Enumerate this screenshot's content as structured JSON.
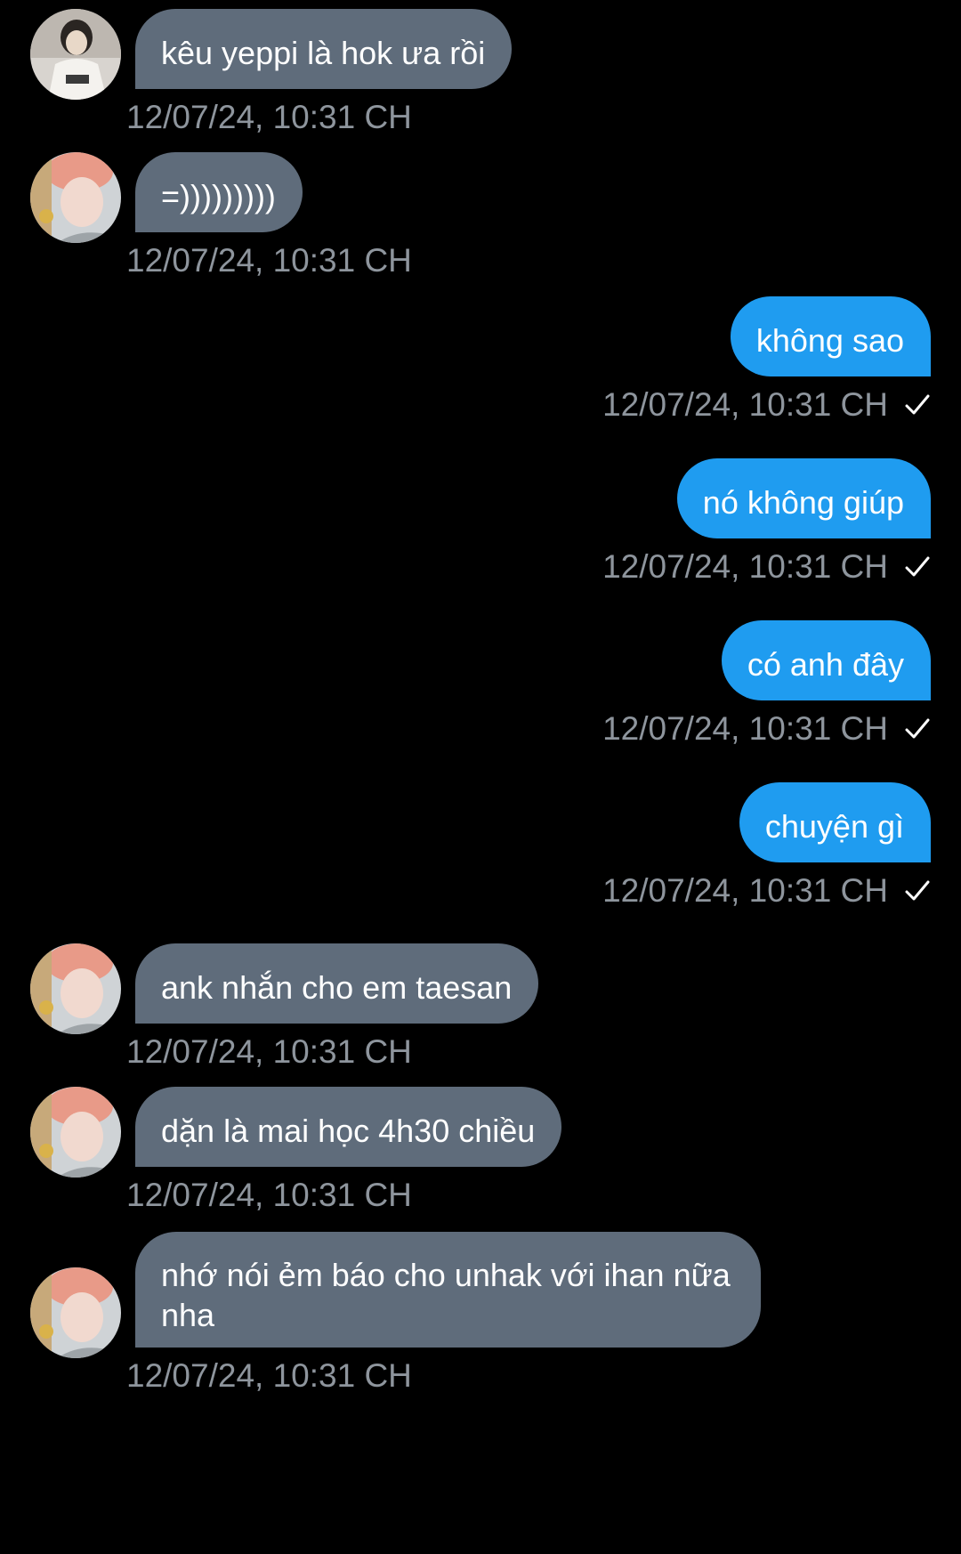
{
  "colors": {
    "background": "#000000",
    "incoming_bubble": "#5f6c7b",
    "outgoing_bubble": "#1f9cf0",
    "timestamp": "#8e959d"
  },
  "messages": [
    {
      "direction": "incoming",
      "avatar": "avatar-user-1",
      "text": "kêu yeppi là hok ưa rồi",
      "time": "12/07/24, 10:31 CH"
    },
    {
      "direction": "incoming",
      "avatar": "avatar-user-2",
      "text": "=)))))))))",
      "time": "12/07/24, 10:31 CH"
    },
    {
      "direction": "outgoing",
      "text": "không sao",
      "time": "12/07/24, 10:31 CH",
      "status_icon": "check-icon"
    },
    {
      "direction": "outgoing",
      "text": "nó không giúp",
      "time": "12/07/24, 10:31 CH",
      "status_icon": "check-icon"
    },
    {
      "direction": "outgoing",
      "text": "có anh đây",
      "time": "12/07/24, 10:31 CH",
      "status_icon": "check-icon"
    },
    {
      "direction": "outgoing",
      "text": "chuyện gì",
      "time": "12/07/24, 10:31 CH",
      "status_icon": "check-icon"
    },
    {
      "direction": "incoming",
      "avatar": "avatar-user-2",
      "text": "ank nhắn cho em taesan",
      "time": "12/07/24, 10:31 CH"
    },
    {
      "direction": "incoming",
      "avatar": "avatar-user-2",
      "text": "dặn là mai học 4h30 chiều",
      "time": "12/07/24, 10:31 CH"
    },
    {
      "direction": "incoming",
      "avatar": "avatar-user-2",
      "text": "nhớ nói ẻm báo cho unhak với ihan nữa nha",
      "time": "12/07/24, 10:31 CH"
    }
  ]
}
